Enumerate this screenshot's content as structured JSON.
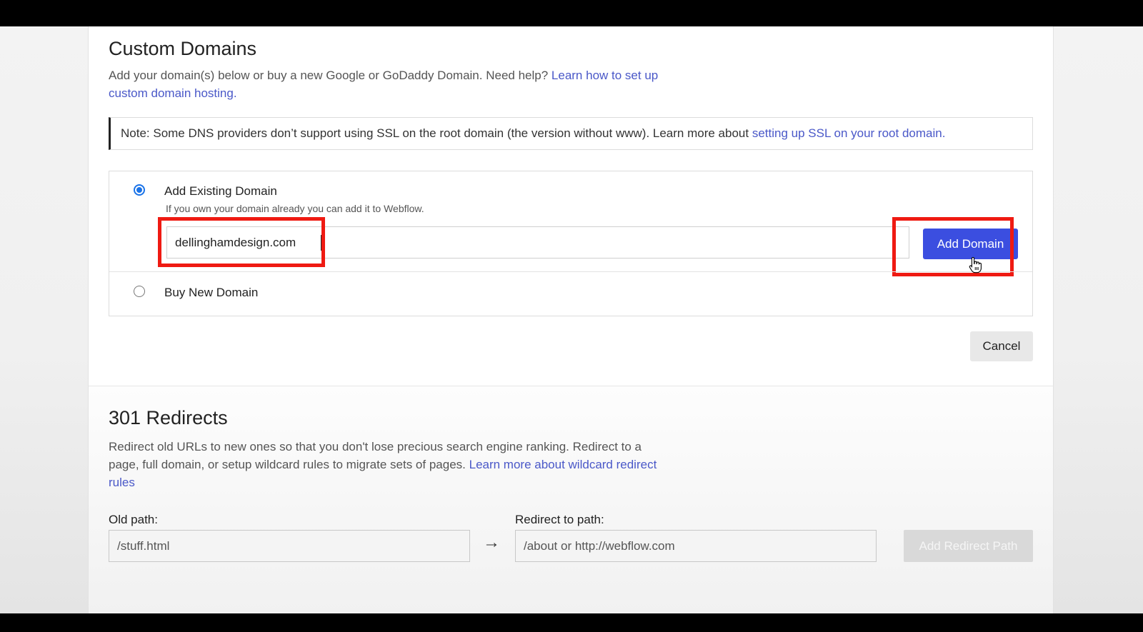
{
  "custom_domains": {
    "title": "Custom Domains",
    "description": "Add your domain(s) below or buy a new Google or GoDaddy Domain. Need help? ",
    "help_link": "Learn how to set up custom domain hosting.",
    "note_text": "Note: Some DNS providers don’t support using SSL on the root domain (the version without www). Learn more about ",
    "note_link": "setting up SSL on your root domain.",
    "options": {
      "add_existing": {
        "label": "Add Existing Domain",
        "help": "If you own your domain already you can add it to Webflow.",
        "input_value": "dellinghamdesign.com",
        "button_label": "Add Domain",
        "selected": true
      },
      "buy_new": {
        "label": "Buy New Domain",
        "selected": false
      }
    },
    "cancel_label": "Cancel"
  },
  "redirects": {
    "title": "301 Redirects",
    "description": "Redirect old URLs to new ones so that you don't lose precious search engine ranking. Redirect to a page, full domain, or setup wildcard rules to migrate sets of pages. ",
    "help_link": "Learn more about wildcard redirect rules",
    "old_path_label": "Old path:",
    "old_path_placeholder": "/stuff.html",
    "redirect_label": "Redirect to path:",
    "redirect_placeholder": "/about or http://webflow.com",
    "add_button_label": "Add Redirect Path",
    "arrow_icon": "→"
  },
  "colors": {
    "primary_button": "#3b4ee0",
    "link": "#4a58c8",
    "highlight": "#ef1a12",
    "radio_selected": "#1a73e8"
  }
}
